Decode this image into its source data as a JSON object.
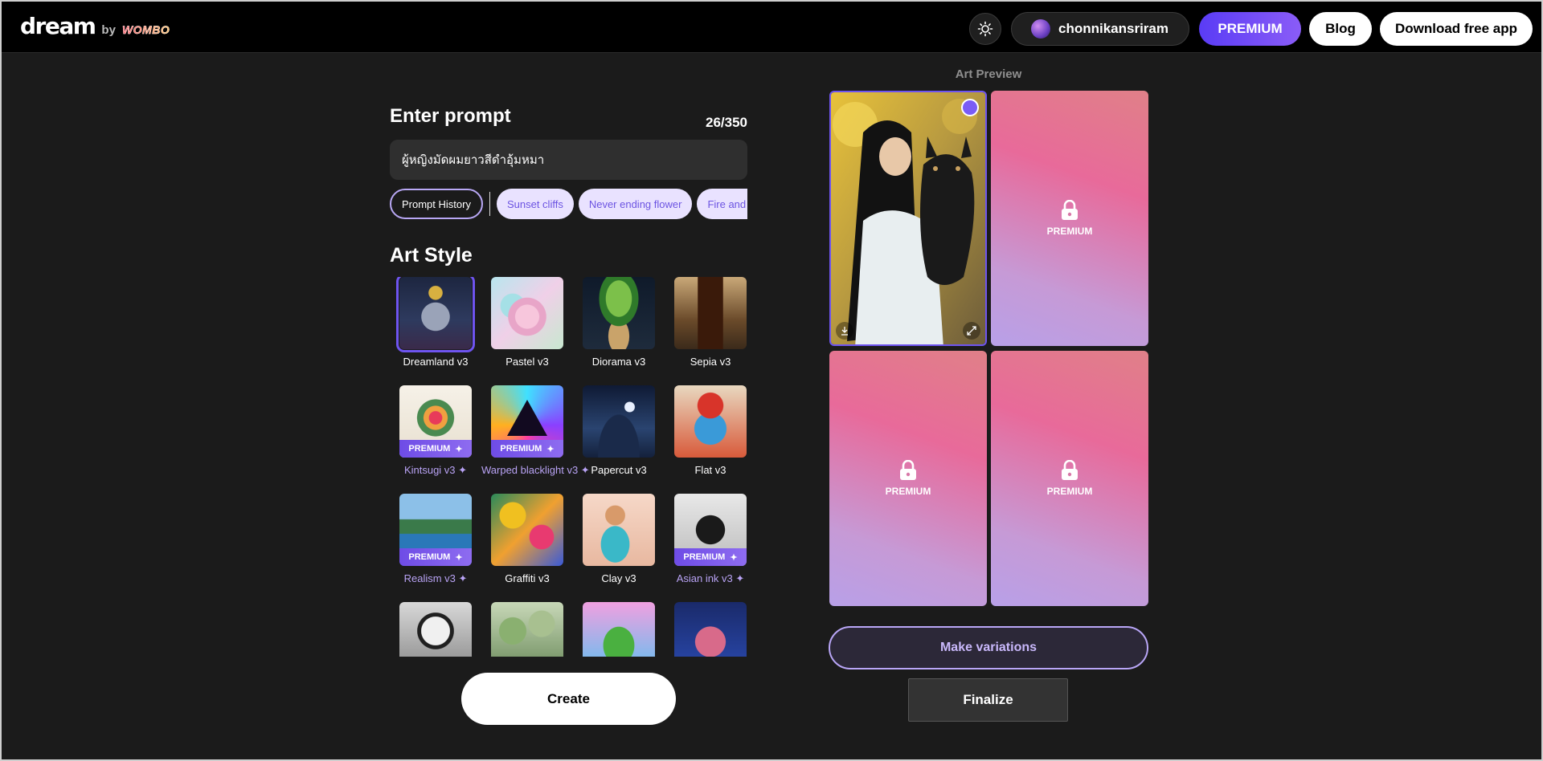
{
  "header": {
    "logo_text": "dream",
    "logo_by": "by",
    "logo_brand": "WOMBO",
    "username": "chonnikansriram",
    "premium_label": "PREMIUM",
    "blog_label": "Blog",
    "download_label": "Download free app"
  },
  "prompt": {
    "title": "Enter prompt",
    "char_count": "26/350",
    "value": "ผู้หญิงมัดผมยาวสีดำอุ้มหมา",
    "history_label": "Prompt History",
    "suggestions": [
      "Sunset cliffs",
      "Never ending flower",
      "Fire and w"
    ]
  },
  "art_style": {
    "title": "Art Style",
    "premium_badge": "PREMIUM",
    "styles": [
      {
        "name": "Dreamland v3",
        "premium": false,
        "selected": true
      },
      {
        "name": "Pastel v3",
        "premium": false
      },
      {
        "name": "Diorama v3",
        "premium": false
      },
      {
        "name": "Sepia v3",
        "premium": false
      },
      {
        "name": "Kintsugi v3 ✦",
        "premium": true
      },
      {
        "name": "Warped blacklight v3 ✦",
        "premium": true
      },
      {
        "name": "Papercut v3",
        "premium": false
      },
      {
        "name": "Flat v3",
        "premium": false
      },
      {
        "name": "Realism v3 ✦",
        "premium": true
      },
      {
        "name": "Graffiti v3",
        "premium": false
      },
      {
        "name": "Clay v3",
        "premium": false
      },
      {
        "name": "Asian ink v3 ✦",
        "premium": true
      }
    ]
  },
  "actions": {
    "create_label": "Create",
    "variations_label": "Make variations",
    "finalize_label": "Finalize"
  },
  "preview": {
    "title": "Art Preview",
    "locked_label": "PREMIUM"
  },
  "colors": {
    "accent": "#6e54f0",
    "premium_gradient_start": "#5a3cf5",
    "background": "#1b1b1b"
  }
}
